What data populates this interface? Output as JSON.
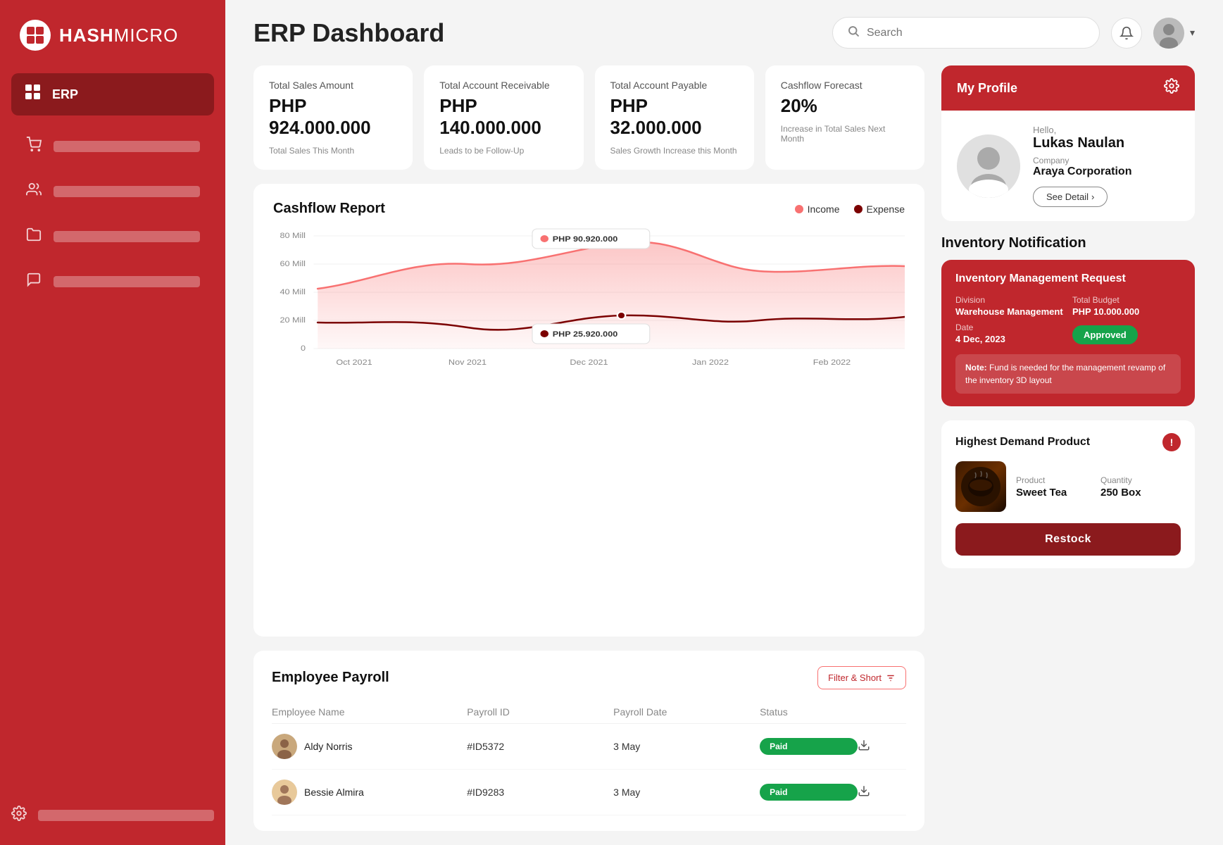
{
  "sidebar": {
    "logo_hash": "#",
    "logo_text_bold": "HASH",
    "logo_text_light": "MICRO",
    "active_item": {
      "label": "ERP",
      "icon": "⊞"
    },
    "nav_items": [
      {
        "icon": "🛍",
        "id": "shopping"
      },
      {
        "icon": "👥",
        "id": "users"
      },
      {
        "icon": "🗂",
        "id": "folder"
      },
      {
        "icon": "💬",
        "id": "chat"
      }
    ],
    "bottom_item": {
      "icon": "⚙"
    }
  },
  "header": {
    "title": "ERP Dashboard",
    "search_placeholder": "Search",
    "notification_icon": "🔔",
    "avatar_chevron": "▾"
  },
  "kpi_cards": [
    {
      "label": "Total Sales Amount",
      "value": "PHP 924.000.000",
      "sub": "Total Sales This Month"
    },
    {
      "label": "Total Account Receivable",
      "value": "PHP 140.000.000",
      "sub": "Leads to be Follow-Up"
    },
    {
      "label": "Total Account Payable",
      "value": "PHP 32.000.000",
      "sub": "Sales Growth Increase this Month"
    },
    {
      "label": "Cashflow Forecast",
      "value": "20%",
      "sub": "Increase in Total Sales Next Month"
    }
  ],
  "cashflow_chart": {
    "title": "Cashflow Report",
    "legend": [
      {
        "label": "Income",
        "color": "#f87171"
      },
      {
        "label": "Expense",
        "color": "#7b0000"
      }
    ],
    "tooltip_income": "PHP 90.920.000",
    "tooltip_expense": "PHP 25.920.000",
    "x_labels": [
      "Oct 2021",
      "Nov 2021",
      "Dec 2021",
      "Jan 2022",
      "Feb 2022"
    ],
    "y_labels": [
      "80 Mill",
      "60 Mill",
      "40 Mill",
      "20 Mill",
      "0"
    ]
  },
  "payroll": {
    "title": "Employee Payroll",
    "filter_label": "Filter & Short",
    "columns": [
      "Employee Name",
      "Payroll ID",
      "Payroll Date",
      "Status",
      ""
    ],
    "rows": [
      {
        "name": "Aldy Norris",
        "id": "#ID5372",
        "date": "3 May",
        "status": "Paid",
        "avatar": "👨"
      },
      {
        "name": "Bessie Almira",
        "id": "#ID9283",
        "date": "3 May",
        "status": "Paid",
        "avatar": "👩"
      }
    ]
  },
  "profile": {
    "section_title": "My Profile",
    "hello": "Hello,",
    "name": "Lukas Naulan",
    "company_label": "Company",
    "company": "Araya Corporation",
    "see_detail": "See Detail",
    "avatar_emoji": "👨"
  },
  "inventory": {
    "section_title": "Inventory Notification",
    "card_title": "Inventory Management Request",
    "division_label": "Division",
    "division": "Warehouse Management",
    "budget_label": "Total Budget",
    "budget": "PHP 10.000.000",
    "date_label": "Date",
    "date": "4 Dec, 2023",
    "status": "Approved",
    "note_prefix": "Note:",
    "note": "Fund is needed for the management revamp of the inventory 3D layout"
  },
  "demand": {
    "title": "Highest Demand Product",
    "product_label": "Product",
    "product": "Sweet Tea",
    "quantity_label": "Quantity",
    "quantity": "250 Box",
    "restock_label": "Restock",
    "alert_icon": "!"
  }
}
